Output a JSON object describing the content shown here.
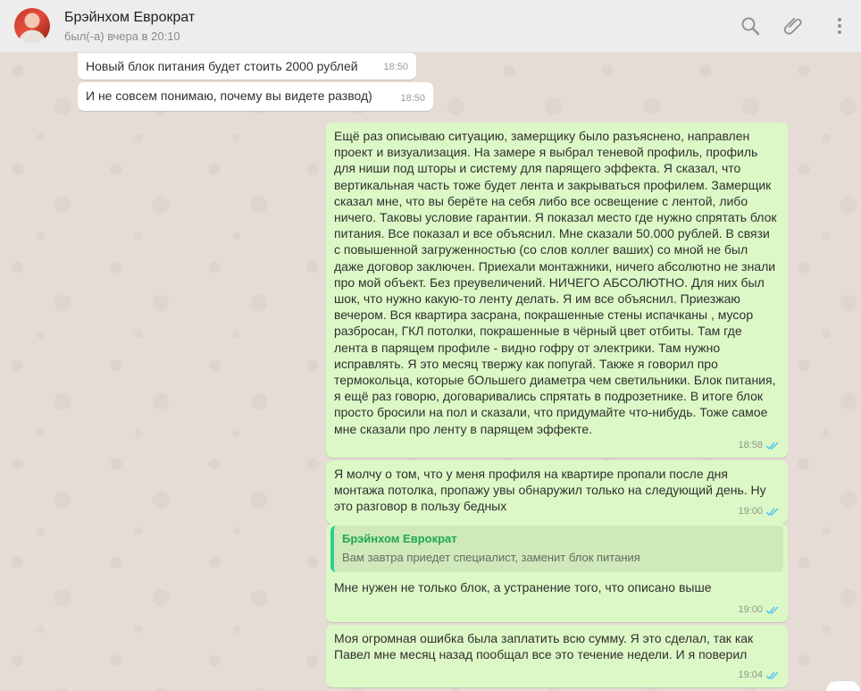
{
  "header": {
    "contact_name": "Брэйнхом Еврократ",
    "status": "был(-а) вчера в 20:10",
    "icons": [
      "search-icon",
      "attach-icon",
      "menu-icon"
    ]
  },
  "colors": {
    "incoming_bubble": "#ffffff",
    "outgoing_bubble": "#dcf8c6",
    "read_check": "#4fc3f7",
    "quote_accent": "#35cd96"
  },
  "messages": [
    {
      "direction": "in",
      "text": "Новый блок питания будет стоить 2000 рублей",
      "time": "18:50"
    },
    {
      "direction": "in",
      "text": "И не совсем понимаю, почему вы видете развод)",
      "time": "18:50"
    },
    {
      "direction": "out",
      "text": "Ещё раз описываю ситуацию, замерщику было разъяснено, направлен проект и визуализация. На замере я выбрал теневой профиль, профиль для ниши под шторы и систему для парящего эффекта. Я сказал, что вертикальная часть тоже будет лента и закрываться профилем. Замерщик сказал мне, что вы берёте на себя либо все освещение с лентой, либо ничего. Таковы условие гарантии. Я показал место где нужно спрятать блок питания. Все показал и все объяснил. Мне сказали 50.000 рублей. В связи с повышенной загруженностью (со слов коллег ваших) со мной не был даже договор заключен. Приехали монтажники, ничего абсолютно не знали про мой объект. Без преувеличений. НИЧЕГО АБСОЛЮТНО. Для них был шок, что нужно какую-то ленту делать. Я им все объяснил. Приезжаю вечером. Вся квартира засрана, покрашенные стены испачканы , мусор разбросан, ГКЛ потолки, покрашенные в чёрный цвет отбиты. Там где лента в парящем профиле - видно гофру от электрики. Там нужно исправлять. Я это месяц твержу как попугай. Также я говорил про термокольца, которые бОльшего диаметра чем светильники. Блок питания, я ещё раз говорю, договаривались спрятать в подрозетнике. В итоге блок просто бросили на пол и сказали, что придумайте что-нибудь. Тоже самое мне сказали про ленту в парящем эффекте.",
      "time": "18:58",
      "read": true
    },
    {
      "direction": "out",
      "text": "Я молчу о том, что у меня профиля на квартире пропали после дня монтажа потолка, пропажу увы обнаружил только на следующий день. Ну это разговор в пользу бедных",
      "time": "19:00",
      "read": true
    },
    {
      "direction": "out",
      "quote_author": "Брэйнхом Еврократ",
      "quote_text": "Вам завтра приедет специалист, заменит блок питания",
      "text": "Мне нужен не только блок, а устранение того, что описано выше",
      "time": "19:00",
      "read": true
    },
    {
      "direction": "out",
      "text": "Моя огромная ошибка была заплатить всю сумму. Я это сделал, так как Павел мне месяц назад пообщал все это течение недели. И я поверил",
      "time": "19:04",
      "read": true
    }
  ]
}
